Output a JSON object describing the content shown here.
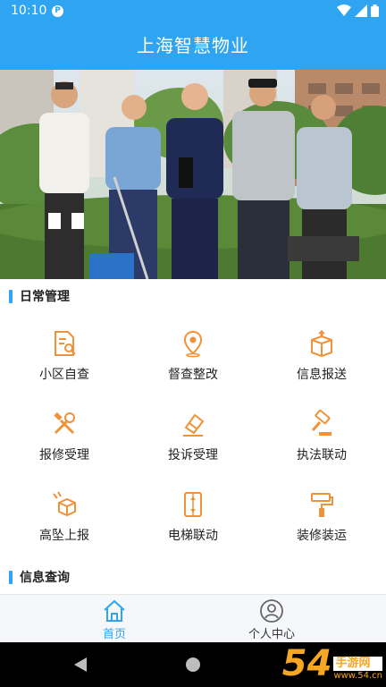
{
  "statusbar": {
    "time": "10:10",
    "app_badge": "P"
  },
  "header": {
    "title": "上海智慧物业"
  },
  "sections": {
    "daily": {
      "title": "日常管理"
    },
    "info": {
      "title": "信息查询"
    }
  },
  "grid": [
    {
      "label": "小区自查",
      "icon": "document-search-icon"
    },
    {
      "label": "督查整改",
      "icon": "location-pin-icon"
    },
    {
      "label": "信息报送",
      "icon": "package-upload-icon"
    },
    {
      "label": "报修受理",
      "icon": "tools-icon"
    },
    {
      "label": "投诉受理",
      "icon": "eraser-edit-icon"
    },
    {
      "label": "执法联动",
      "icon": "gavel-icon"
    },
    {
      "label": "高坠上报",
      "icon": "falling-box-icon"
    },
    {
      "label": "电梯联动",
      "icon": "elevator-icon"
    },
    {
      "label": "装修装运",
      "icon": "paint-roller-icon"
    }
  ],
  "bottomnav": [
    {
      "label": "首页",
      "icon": "home-icon",
      "active": true
    },
    {
      "label": "个人中心",
      "icon": "user-icon",
      "active": false
    }
  ],
  "watermark": {
    "num": "54",
    "cn": "手游网",
    "url": "www.54.cn"
  },
  "colors": {
    "primary": "#2fa5f2",
    "icon_orange": "#f0923a"
  }
}
